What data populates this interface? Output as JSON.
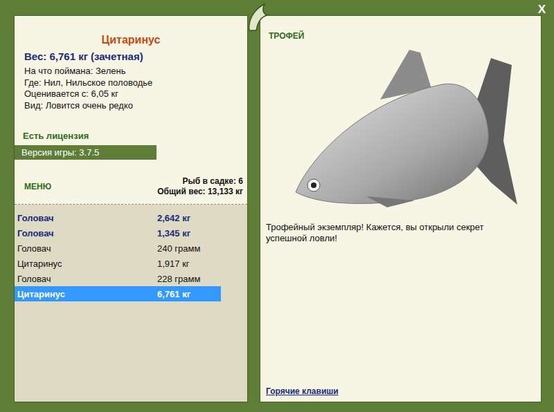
{
  "window": {
    "close": "X"
  },
  "fish_card": {
    "name": "Цитаринус",
    "weight": "Вес: 6,761 кг (зачетная)",
    "details": [
      "На что поймана: Зелень",
      "Где: Нил, Нильское половодье",
      "Оценивается с: 6,05 кг",
      "Вид: Ловится очень редко"
    ],
    "license": "Есть лицензия",
    "version": "Версия игры: 3.7.5"
  },
  "menu": {
    "label": "МЕНЮ",
    "count": "Рыб в садке: 6",
    "total": "Общий вес: 13,133 кг"
  },
  "catch_list": [
    {
      "name": "Головач",
      "weight": "2,642 кг",
      "trophy": true,
      "selected": false
    },
    {
      "name": "Головач",
      "weight": "1,345 кг",
      "trophy": true,
      "selected": false
    },
    {
      "name": "Головач",
      "weight": "240 грамм",
      "trophy": false,
      "selected": false
    },
    {
      "name": "Цитаринус",
      "weight": "1,917 кг",
      "trophy": false,
      "selected": false
    },
    {
      "name": "Головач",
      "weight": "228 грамм",
      "trophy": false,
      "selected": false
    },
    {
      "name": "Цитаринус",
      "weight": "6,761 кг",
      "trophy": true,
      "selected": true
    }
  ],
  "trophy": {
    "label": "ТРОФЕЙ",
    "message": "Трофейный экземпляр! Кажется, вы открыли секрет успешной ловли!",
    "hotkeys": "Горячие клавиши"
  }
}
